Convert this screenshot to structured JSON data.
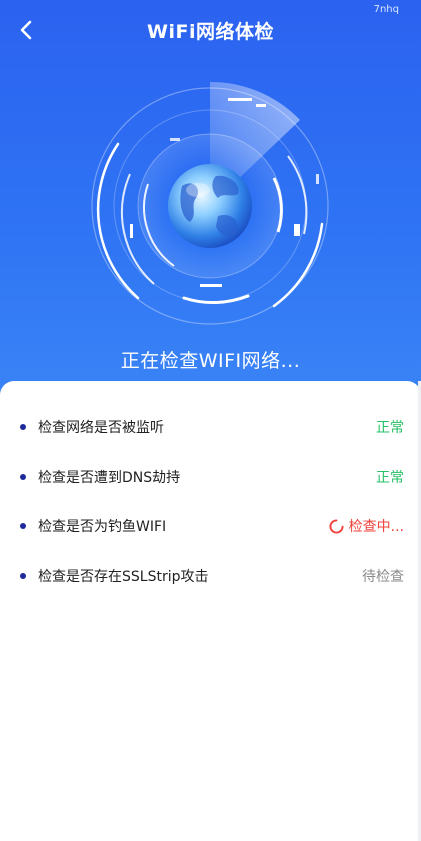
{
  "header": {
    "title": "WiFi网络体检",
    "corner_tag": "7nhq",
    "back_icon": "chevron-left-icon"
  },
  "scan": {
    "status_text": "正在检查WIFI网络...",
    "visual": "radar-globe"
  },
  "checks": [
    {
      "label": "检查网络是否被监听",
      "status": "正常",
      "state": "ok"
    },
    {
      "label": "检查是否遭到DNS劫持",
      "status": "正常",
      "state": "ok"
    },
    {
      "label": "检查是否为钓鱼WIFI",
      "status": "检查中...",
      "state": "checking"
    },
    {
      "label": "检查是否存在SSLStrip攻击",
      "status": "待检查",
      "state": "pending"
    }
  ],
  "colors": {
    "primary_blue": "#2b62f0",
    "ok_green": "#26c067",
    "checking_red": "#f0413a",
    "pending_gray": "#8a8a8a",
    "bullet_navy": "#1f2a9a"
  }
}
